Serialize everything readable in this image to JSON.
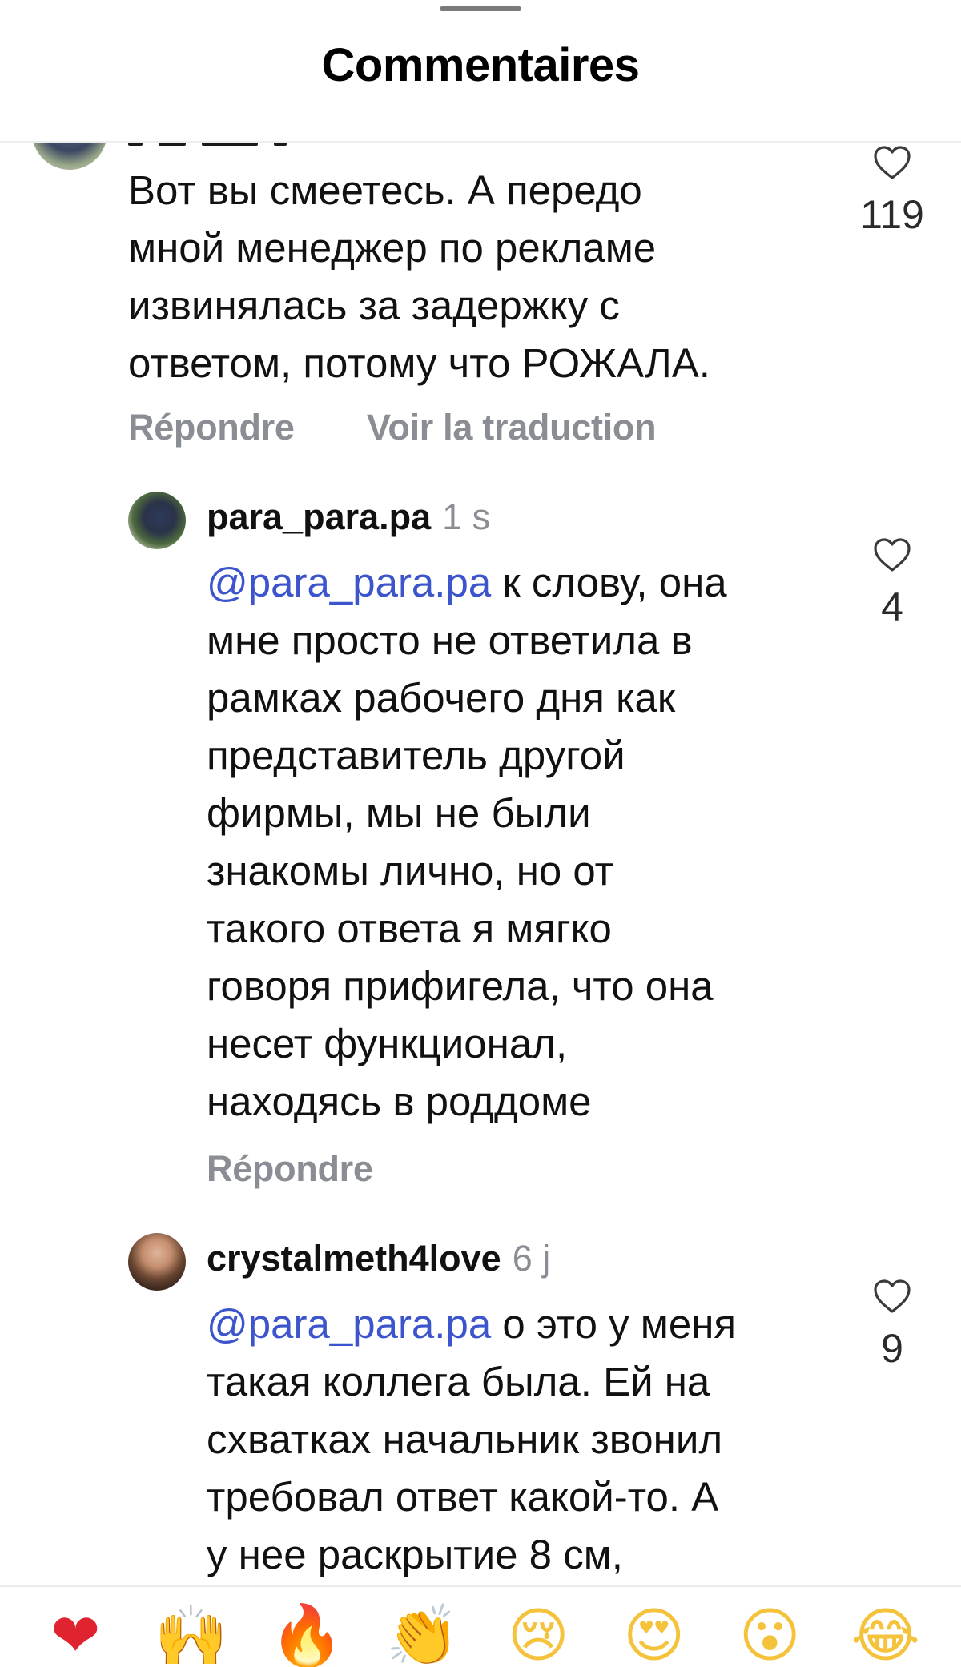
{
  "header": {
    "title": "Commentaires"
  },
  "comments": [
    {
      "text": "Вот вы смеетесь. А передо\nмной менеджер по рекламе\nизвинялась за задержку с\nответом, потому что РОЖАЛА.",
      "likes": "119",
      "reply_label": "Répondre",
      "translate_label": "Voir la traduction"
    }
  ],
  "replies": [
    {
      "username": "para_para.pa",
      "time": "1 s",
      "mention": "@para_para.pa",
      "text": " к слову, она\nмне просто не ответила в\nрамках рабочего дня как\nпредставитель другой\nфирмы, мы не были\nзнакомы лично, но от\nтакого ответа я мягко\nговоря прифигела, что она\nнесет функционал,\nнаходясь в роддоме",
      "likes": "4",
      "reply_label": "Répondre"
    },
    {
      "username": "crystalmeth4love",
      "time": "6 j",
      "mention": "@para_para.pa",
      "text": " о это у меня\nтакая коллега была. Ей на\nсхватках начальник звонил\nтребовал ответ какой-то. А\nу нее раскрытие 8 см,",
      "likes": "9"
    }
  ],
  "reactions": [
    {
      "name": "heart-emoji",
      "glyph": "❤"
    },
    {
      "name": "raising-hands-emoji",
      "glyph": "🙌"
    },
    {
      "name": "fire-emoji",
      "glyph": "🔥"
    },
    {
      "name": "clapping-hands-emoji",
      "glyph": "👏"
    },
    {
      "name": "crying-face-emoji",
      "glyph": "😢"
    },
    {
      "name": "heart-eyes-emoji",
      "glyph": "😍"
    },
    {
      "name": "surprised-face-emoji",
      "glyph": "😮"
    },
    {
      "name": "tears-of-joy-emoji",
      "glyph": "😂"
    }
  ],
  "colors": {
    "mention": "#3d55cc",
    "secondary_text": "#8a8d93",
    "reaction_heart": "#e0242f"
  },
  "icons": {
    "like": "heart-outline-icon",
    "grabber": "sheet-handle"
  }
}
